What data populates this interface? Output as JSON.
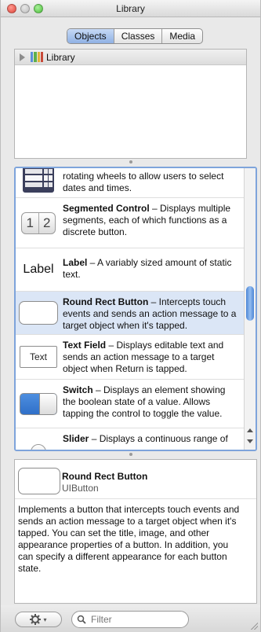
{
  "window": {
    "title": "Library"
  },
  "tabs": [
    {
      "label": "Objects",
      "active": true
    },
    {
      "label": "Classes",
      "active": false
    },
    {
      "label": "Media",
      "active": false
    }
  ],
  "tree": {
    "root_label": "Library"
  },
  "items": [
    {
      "name": "",
      "description": "rotating wheels to allow users to select dates and times.",
      "icon": "date-picker-icon"
    },
    {
      "name": "Segmented Control",
      "description": " – Displays multiple segments, each of which functions as a discrete button.",
      "icon": "segmented-control-icon",
      "icon_text_1": "1",
      "icon_text_2": "2"
    },
    {
      "name": "Label",
      "description": " – A variably sized amount of static text.",
      "icon": "label-icon",
      "icon_text": "Label"
    },
    {
      "name": "Round Rect Button",
      "description": " – Intercepts touch events and sends an action message to a target object when it's tapped.",
      "icon": "round-rect-button-icon",
      "selected": true
    },
    {
      "name": "Text Field",
      "description": " – Displays editable text and sends an action message to a target object when Return is tapped.",
      "icon": "text-field-icon",
      "icon_text": "Text"
    },
    {
      "name": "Switch",
      "description": " – Displays an element showing the boolean state of a value. Allows tapping the control to toggle the value.",
      "icon": "switch-icon"
    },
    {
      "name": "Slider",
      "description": " – Displays a continuous range of",
      "icon": "slider-icon"
    }
  ],
  "details": {
    "name": "Round Rect Button",
    "class_name": "UIButton",
    "description": "Implements a button that intercepts touch events and sends an action message to a target object when it's tapped. You can set the title, image, and other appearance properties of a button. In addition, you can specify a different appearance for each button state."
  },
  "bottom": {
    "filter_placeholder": "Filter",
    "action_icon": "gear-icon"
  },
  "colors": {
    "selection": "#dbe6f6",
    "list_border": "#7ea4db",
    "scroll_thumb": "#4d86d6",
    "active_tab": "#8fb1e4"
  }
}
